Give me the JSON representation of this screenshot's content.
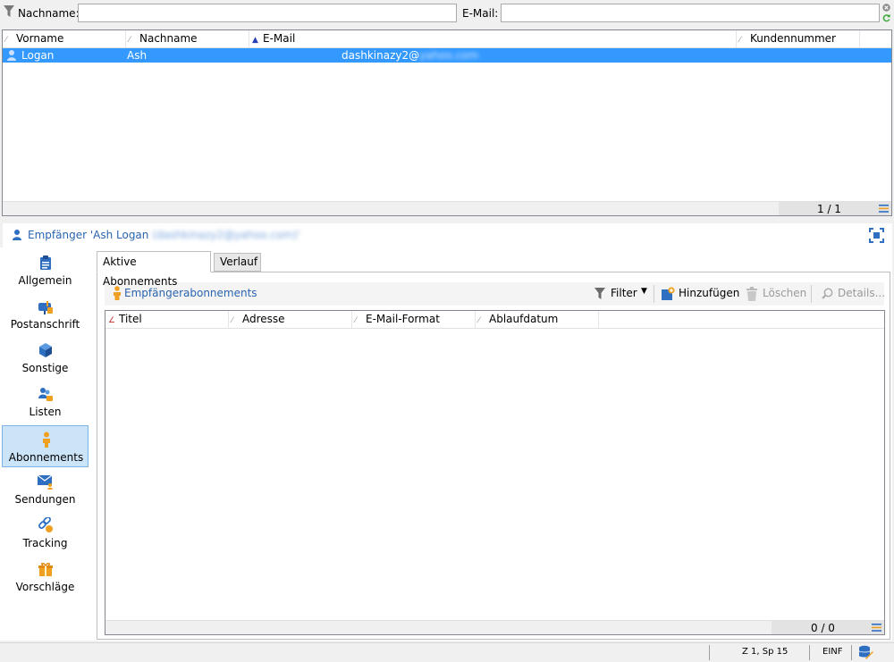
{
  "filter": {
    "lastname_label": "Nachname:",
    "lastname_value": "",
    "email_label": "E-Mail:",
    "email_value": ""
  },
  "recipients_grid": {
    "columns": [
      {
        "label": "Vorname",
        "sort": "none"
      },
      {
        "label": "Nachname",
        "sort": "none"
      },
      {
        "label": "E-Mail",
        "sort": "ascending"
      },
      {
        "label": "Kundennummer",
        "sort": "none"
      }
    ],
    "rows": [
      {
        "first_name": "Logan",
        "last_name": "Ash",
        "email_visible": "dashkinazy2@",
        "email_obscured": "yahoo.com",
        "customer_number": "",
        "selected": true
      }
    ],
    "pager": "1 / 1"
  },
  "recipient_header": {
    "title": "Empfänger 'Ash Logan",
    "title_obscured": "(dashkinazy2@yahoo.com)'"
  },
  "left_nav": [
    {
      "label": "Allgemein",
      "icon": "clipboard-icon",
      "active": false
    },
    {
      "label": "Postanschrift",
      "icon": "mailbox-icon",
      "active": false
    },
    {
      "label": "Sonstige",
      "icon": "cube-icon",
      "active": false
    },
    {
      "label": "Listen",
      "icon": "users-list-icon",
      "active": false
    },
    {
      "label": "Abonnements",
      "icon": "person-icon",
      "active": true
    },
    {
      "label": "Sendungen",
      "icon": "envelope-person-icon",
      "active": false
    },
    {
      "label": "Tracking",
      "icon": "tracking-link-icon",
      "active": false
    },
    {
      "label": "Vorschläge",
      "icon": "gift-icon",
      "active": false
    }
  ],
  "tabs": [
    {
      "label": "Aktive Abonnements",
      "active": true
    },
    {
      "label": "Verlauf",
      "active": false
    }
  ],
  "subscriptions_toolbar": {
    "title": "Empfängerabonnements",
    "filter_label": "Filter",
    "add_label": "Hinzufügen",
    "delete_label": "Löschen",
    "details_label": "Details..."
  },
  "subscriptions_grid": {
    "columns": [
      {
        "label": "Titel",
        "sort": "none"
      },
      {
        "label": "Adresse",
        "sort": "none"
      },
      {
        "label": "E-Mail-Format",
        "sort": "none"
      },
      {
        "label": "Ablaufdatum",
        "sort": "none"
      }
    ],
    "rows": [],
    "pager": "0 / 0"
  },
  "status_bar": {
    "position": "Z 1, Sp 15",
    "mode": "EINF"
  },
  "colors": {
    "selection": "#3399ff",
    "link_blue": "#2a64b0",
    "nav_active_bg": "#cce4f7",
    "icon_blue": "#2f6fc2",
    "icon_orange": "#f0a020"
  }
}
